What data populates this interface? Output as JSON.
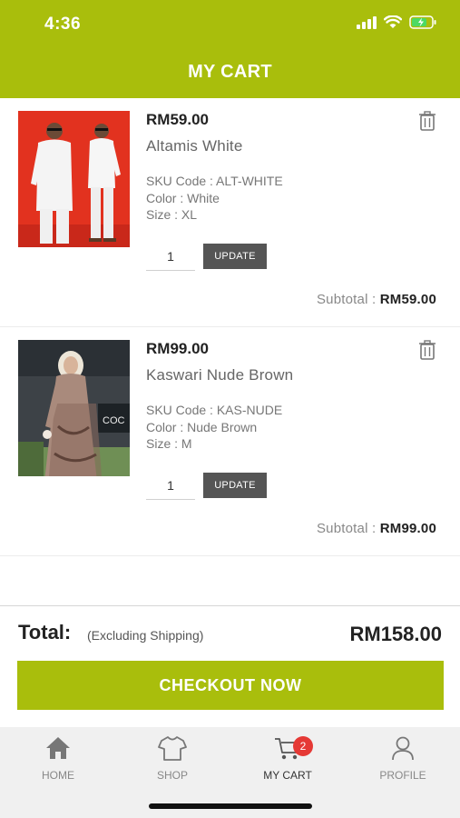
{
  "status_bar": {
    "time": "4:36"
  },
  "header": {
    "title": "MY CART"
  },
  "items": [
    {
      "price": "RM59.00",
      "name": "Altamis White",
      "sku": "SKU Code : ALT-WHITE",
      "color": "Color : White",
      "size": "Size : XL",
      "quantity": "1",
      "update_label": "UPDATE",
      "subtotal_label": "Subtotal :",
      "subtotal_value": "RM59.00"
    },
    {
      "price": "RM99.00",
      "name": "Kaswari Nude Brown",
      "sku": "SKU Code : KAS-NUDE",
      "color": "Color : Nude Brown",
      "size": "Size : M",
      "quantity": "1",
      "update_label": "UPDATE",
      "subtotal_label": "Subtotal :",
      "subtotal_value": "RM99.00"
    }
  ],
  "summary": {
    "total_label": "Total:",
    "total_note": "(Excluding Shipping)",
    "total_amount": "RM158.00",
    "checkout_label": "CHECKOUT NOW"
  },
  "tabbar": {
    "home": "HOME",
    "shop": "SHOP",
    "cart": "MY CART",
    "cart_badge": "2",
    "profile": "PROFILE"
  },
  "colors": {
    "accent": "#a9be0c",
    "badge": "#e53935",
    "button_dark": "#555555"
  },
  "icons": [
    "signal-icon",
    "wifi-icon",
    "battery-icon",
    "trash-icon",
    "home-icon",
    "shirt-icon",
    "cart-icon",
    "profile-icon"
  ]
}
